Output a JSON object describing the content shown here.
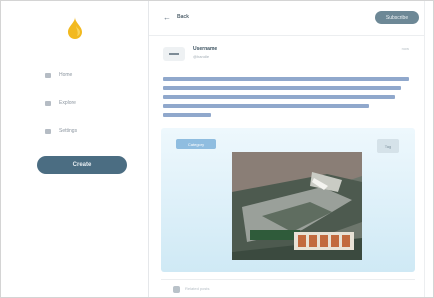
{
  "sidebar": {
    "items": [
      {
        "label": "Home",
        "icon": "home-icon"
      },
      {
        "label": "Explore",
        "icon": "explore-icon"
      },
      {
        "label": "Settings",
        "icon": "settings-icon"
      }
    ],
    "button_label": "Create"
  },
  "header": {
    "title": "Back",
    "button_label": "Subscribe"
  },
  "post": {
    "name": "Username",
    "handle": "@handle",
    "time": "now",
    "text": ""
  },
  "card": {
    "tag": "Category",
    "chip": "Tag"
  },
  "footer": {
    "text": "Related posts"
  },
  "colors": {
    "accent": "#4b6d82",
    "link": "#90a8cc",
    "logo": "#f2b91f"
  }
}
